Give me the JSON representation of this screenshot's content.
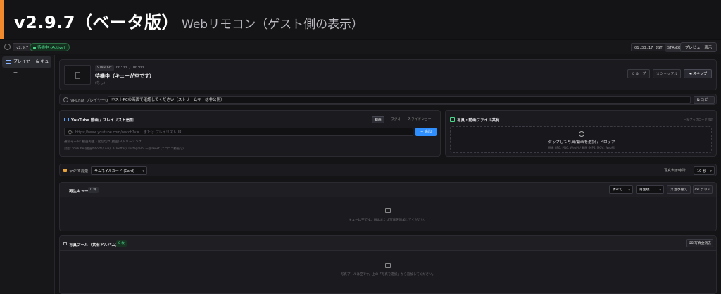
{
  "banner": {
    "version_title": "v2.9.7（ベータ版）",
    "subtitle": "Webリモコン（ゲスト側の表示）",
    "accent_color": "#f08a2c"
  },
  "topbar": {
    "version": "v2.9.7",
    "status": "待機中 (Active)",
    "clock": "01:33:17 JST",
    "clock_state": "STANDBY",
    "preview_button": "プレビュー表示"
  },
  "sidebar": {
    "items": [
      {
        "label": "プレイヤー & キュー",
        "icon": "list-icon",
        "active": true
      }
    ]
  },
  "now_playing": {
    "badge": "STANDBY",
    "time": "00:00 / 00:00",
    "title": "待機中（キューが空です）",
    "description": "(なし)",
    "controls": {
      "loop": "ループ",
      "shuffle": "シャッフル",
      "skip": "スキップ"
    }
  },
  "vrchat": {
    "label": "VRChat プレイヤーURL:",
    "url_value": "ホストPCの画面で確認してください（ストリームキーは非公開）",
    "copy_button": "コピー"
  },
  "youtube": {
    "heading": "YouTube 動画 / プレイリスト追加",
    "modes": [
      "動画",
      "ラジオ",
      "スライドショー"
    ],
    "active_mode": "動画",
    "input_placeholder": "https://www.youtube.com/watch?v=... または プレイリストURL",
    "add_button": "+ 追加",
    "note1": "通常モード: 動画再生・配信切れ(動画)ストリーミング",
    "note2": "対応: YouTube (動画/Shorts/Live), X(Twitter), Instagram, 一部Tweet (ニコニコ動画可)"
  },
  "photo_share": {
    "heading": "写真・動画ファイル共有",
    "limit_note": "一括アップロード対応",
    "drop_title": "タップして写真/動画を選択 / ドロップ",
    "drop_formats": "画像 (JPG, PNG, WebP) / 動画 (MP4, MOV, WebM)"
  },
  "radio": {
    "bg_label": "ラジオ背景:",
    "bg_value": "サムネイルカード (Card)",
    "photo_time_label": "写真表示時間:",
    "photo_time_value": "10 秒"
  },
  "queue": {
    "heading": "再生キュー",
    "count": "0 件",
    "filter_value": "すべて",
    "sort_value": "再生順",
    "reorder_button": "並び替え",
    "clear_button": "クリア",
    "empty_text": "キューは空です。URLまたは写真を追加してください。"
  },
  "photo_pool": {
    "heading": "写真プール（共有アルバム）",
    "count": "0 枚",
    "clear_all_button": "写真全消去",
    "empty_text": "写真プールは空です。上の「写真を選択」から追加してください。"
  }
}
